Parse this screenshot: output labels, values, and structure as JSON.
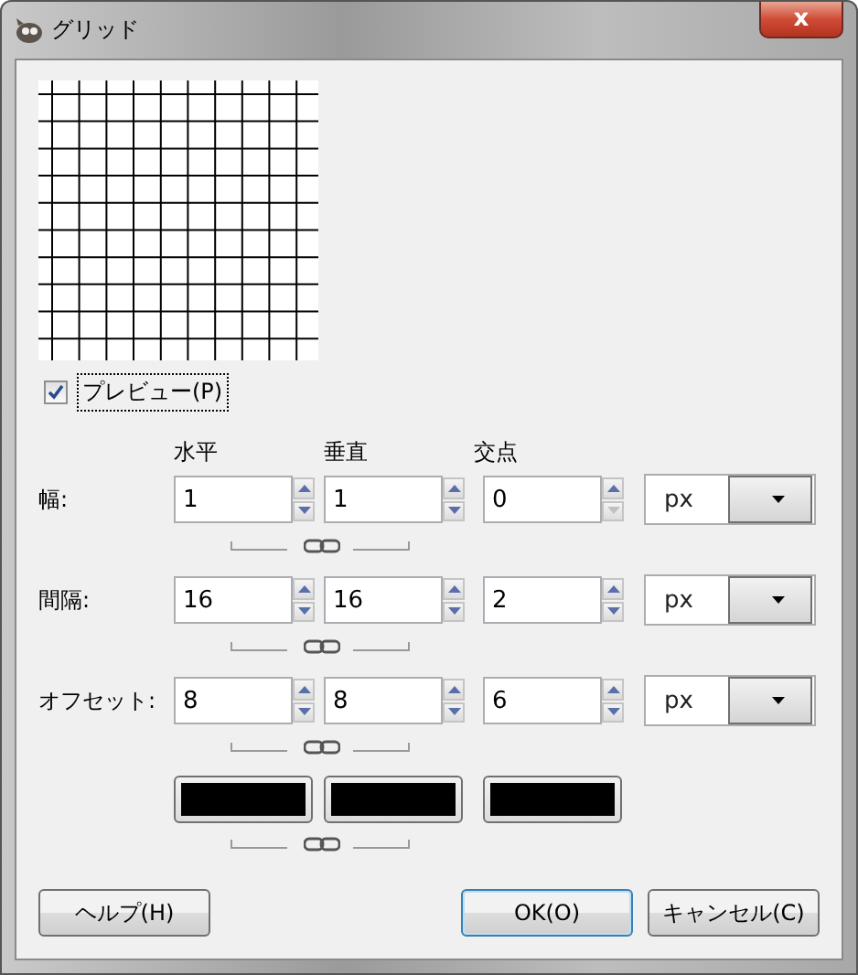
{
  "window": {
    "title": "グリッド",
    "close_label": "x"
  },
  "preview": {
    "label": "プレビュー(P)",
    "checked": true
  },
  "columns": [
    "水平",
    "垂直",
    "交点"
  ],
  "rows": [
    {
      "label": "幅:",
      "values": [
        {
          "value": "1",
          "down_enabled": true
        },
        {
          "value": "1",
          "down_enabled": true
        },
        {
          "value": "0",
          "down_enabled": false
        }
      ],
      "unit": "px"
    },
    {
      "label": "間隔:",
      "values": [
        {
          "value": "16",
          "down_enabled": true
        },
        {
          "value": "16",
          "down_enabled": true
        },
        {
          "value": "2",
          "down_enabled": true
        }
      ],
      "unit": "px"
    },
    {
      "label": "オフセット:",
      "values": [
        {
          "value": "8",
          "down_enabled": true
        },
        {
          "value": "8",
          "down_enabled": true
        },
        {
          "value": "6",
          "down_enabled": true
        }
      ],
      "unit": "px"
    }
  ],
  "colors": [
    {
      "color": "#000000"
    },
    {
      "color": "#000000"
    },
    {
      "color": "#000000"
    }
  ],
  "buttons": [
    {
      "label": "ヘルプ(H)",
      "kind": "help"
    },
    {
      "label": "OK(O)",
      "kind": "default"
    },
    {
      "label": "キャンセル(C)",
      "kind": "normal"
    }
  ]
}
